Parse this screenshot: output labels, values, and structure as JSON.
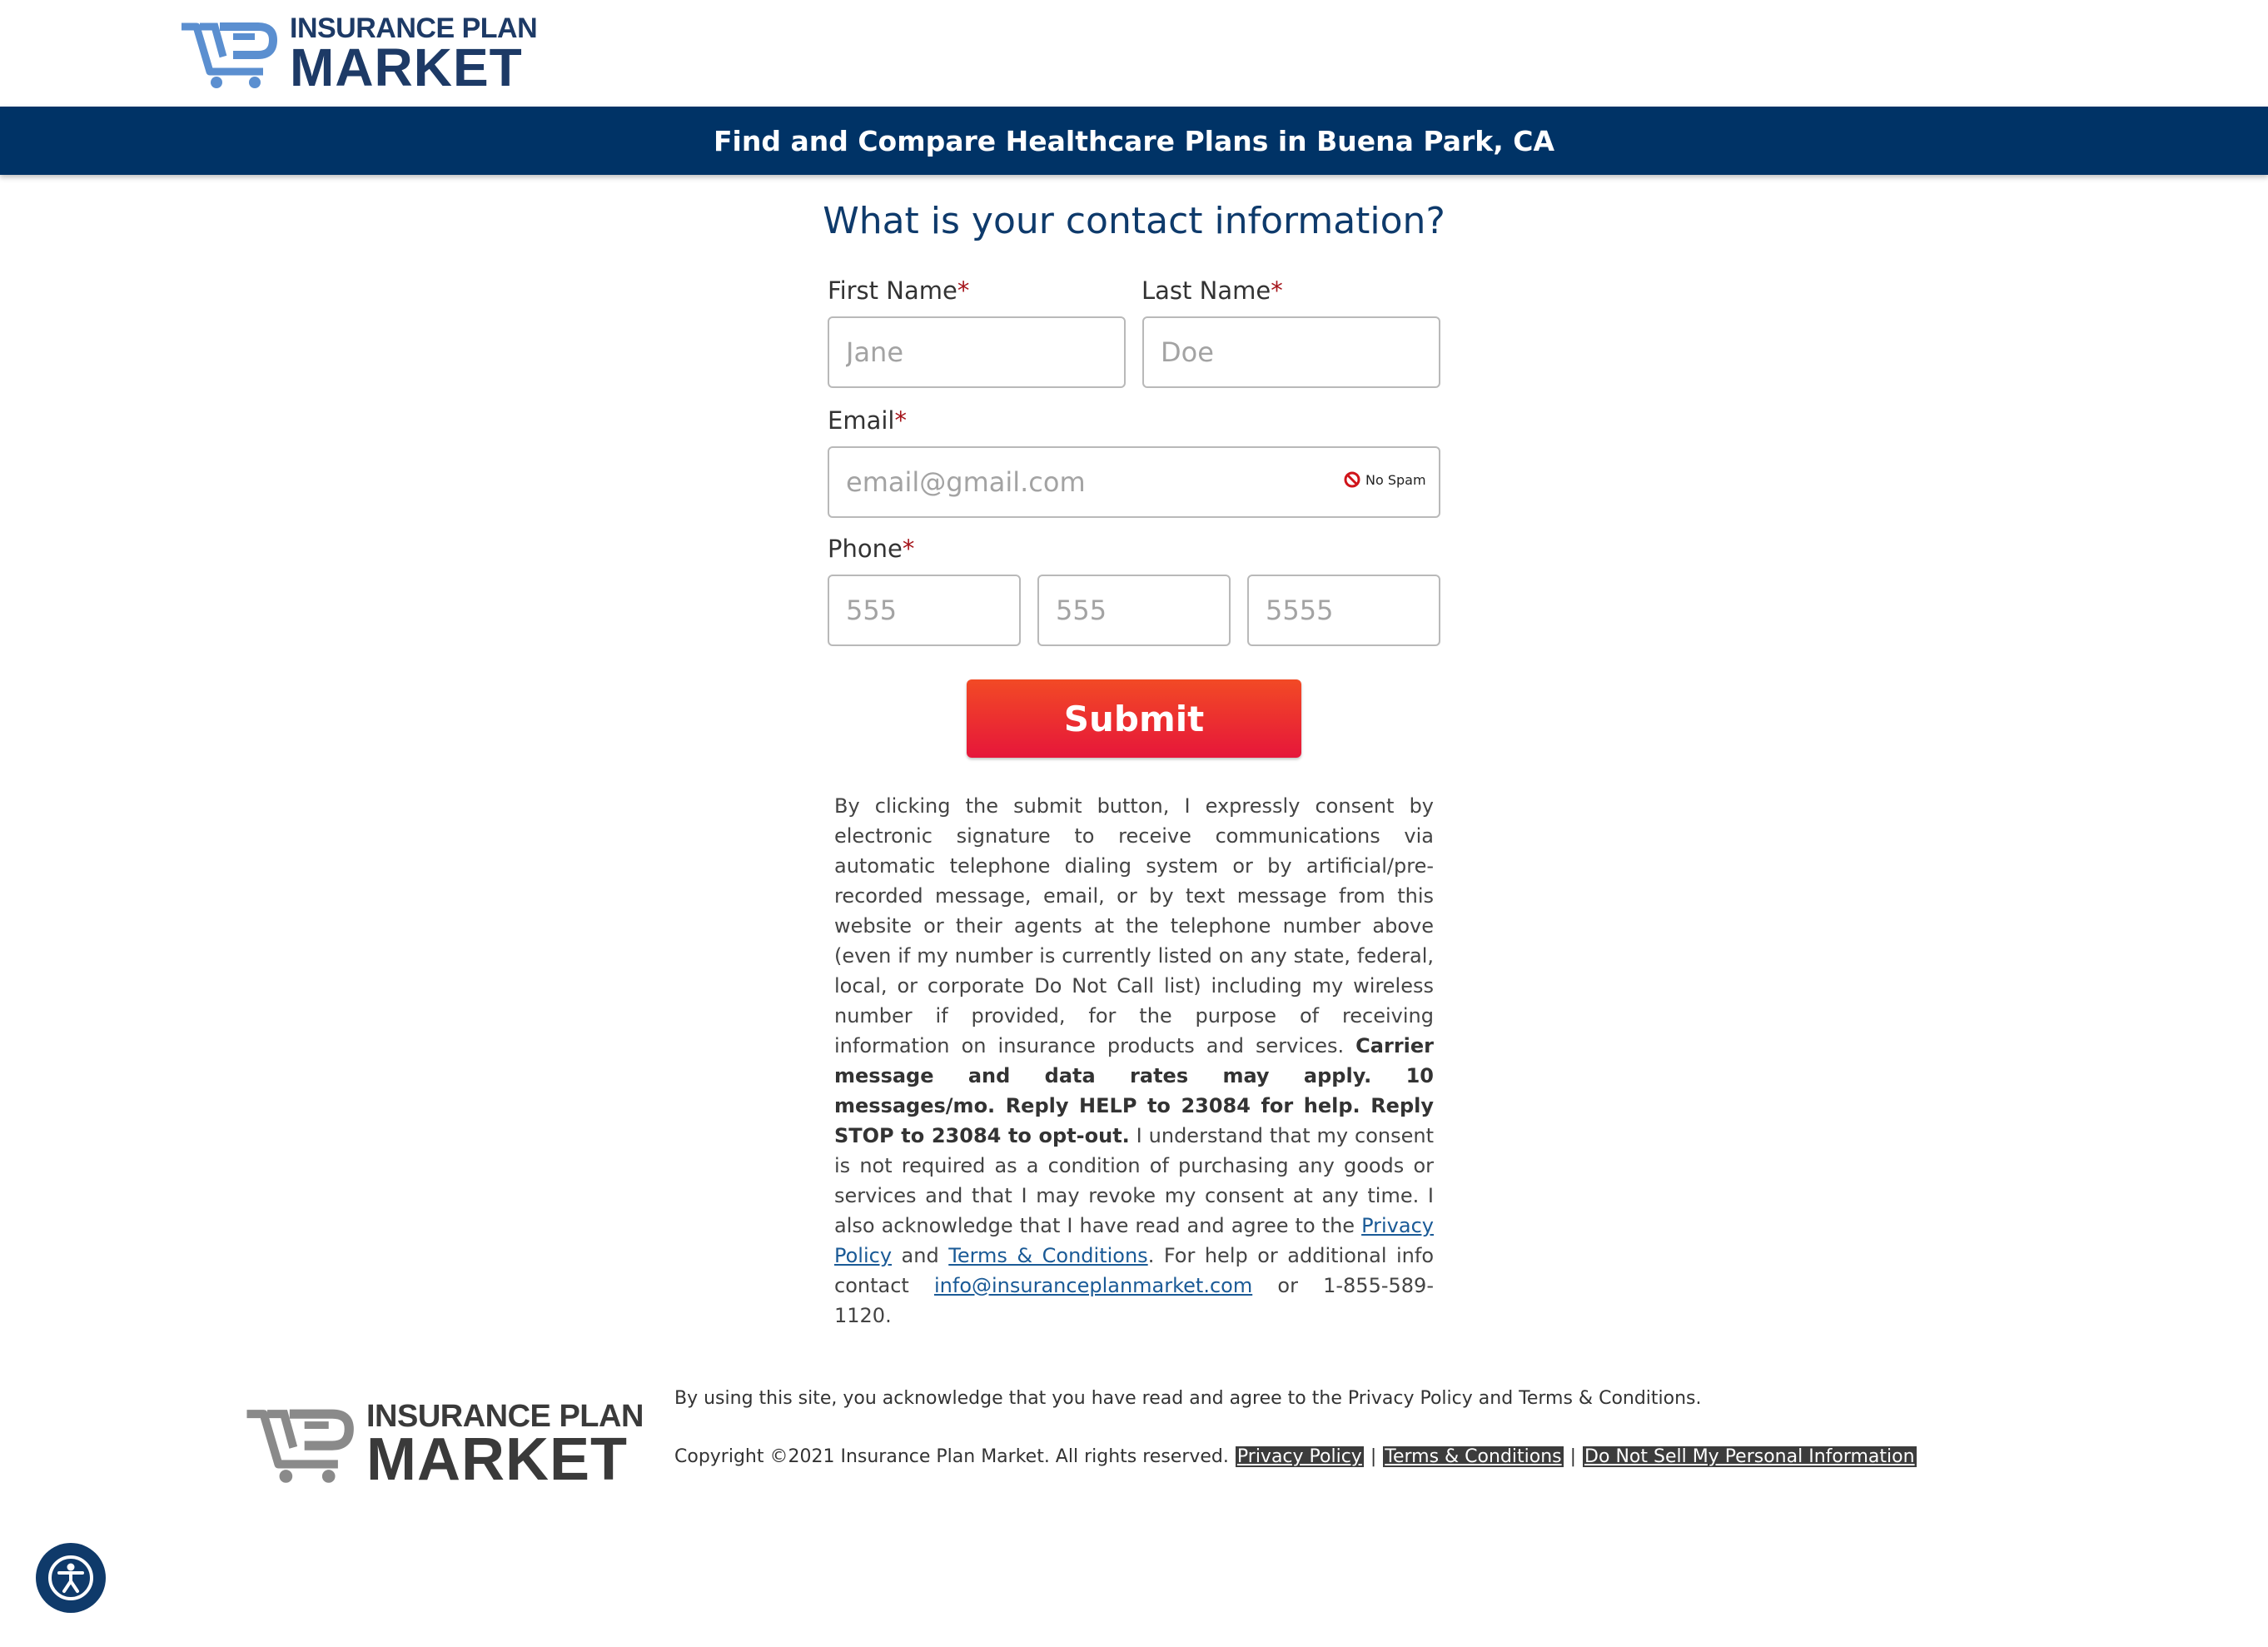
{
  "brand": {
    "line1": "INSURANCE PLAN",
    "line2": "MARKET",
    "primary_color": "#003366",
    "logo_blue": "#5b8fd0",
    "logo_gray": "#8a8a8a"
  },
  "banner": {
    "title": "Find and Compare Healthcare Plans in Buena Park, CA"
  },
  "form": {
    "title": "What is your contact information?",
    "required_mark": "*",
    "first_name": {
      "label": "First Name",
      "placeholder": "Jane",
      "value": ""
    },
    "last_name": {
      "label": "Last Name",
      "placeholder": "Doe",
      "value": ""
    },
    "email": {
      "label": "Email",
      "placeholder": "email@gmail.com",
      "value": "",
      "badge": "No Spam",
      "badge_icon": "no-spam-icon"
    },
    "phone": {
      "label": "Phone",
      "area": {
        "placeholder": "555",
        "value": ""
      },
      "prefix": {
        "placeholder": "555",
        "value": ""
      },
      "line": {
        "placeholder": "5555",
        "value": ""
      }
    },
    "submit_label": "Submit",
    "submit_color": "#ee2e2e"
  },
  "consent": {
    "part1": "By clicking the submit button, I expressly consent by electronic signature to receive communications via automatic telephone dialing system or by artificial/pre-recorded message, email, or by text message from this website or their agents at the telephone number above (even if my number is currently listed on any state, federal, local, or corporate Do Not Call list) including my wireless number if provided, for the purpose of receiving information on insurance products and services. ",
    "bold": "Carrier message and data rates may apply. 10 messages/mo. Reply HELP to 23084 for help. Reply STOP to 23084 to opt-out.",
    "part2": " I understand that my consent is not required as a condition of purchasing any goods or services and that I may revoke my consent at any time. I also acknowledge that I have read and agree to the ",
    "privacy_link": "Privacy Policy",
    "and": " and ",
    "terms_link": "Terms & Conditions",
    "part3": ". For help or additional info contact ",
    "email_link": "info@insuranceplanmarket.com",
    "part4": " or 1-855-589-1120."
  },
  "footer": {
    "acknowledge": "By using this site, you acknowledge that you have read and agree to the Privacy Policy and Terms & Conditions.",
    "copyright": "Copyright ©2021 Insurance Plan Market. All rights reserved.",
    "links": {
      "privacy": "Privacy Policy",
      "terms": "Terms & Conditions",
      "do_not_sell": "Do Not Sell My Personal Information"
    },
    "separator": "|"
  },
  "accessibility": {
    "icon": "accessibility-icon"
  }
}
